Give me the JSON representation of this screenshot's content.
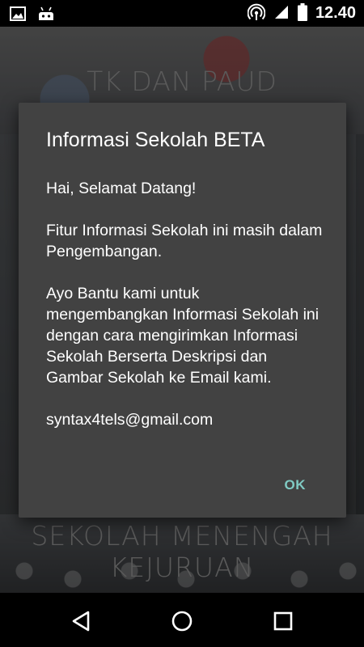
{
  "status_bar": {
    "time": "12.40",
    "icons": [
      "image-icon",
      "android-icon",
      "hotspot-icon",
      "signal-icon",
      "battery-icon"
    ]
  },
  "app": {
    "banner_top_title": "TK DAN PAUD",
    "banner_bottom_title": "SEKOLAH MENENGAH KEJURUAN"
  },
  "dialog": {
    "title": "Informasi Sekolah BETA",
    "paragraphs": [
      "Hai, Selamat Datang!",
      "Fitur Informasi Sekolah ini masih dalam Pengembangan.",
      "Ayo Bantu kami untuk mengembangkan Informasi Sekolah ini dengan cara mengirimkan Informasi Sekolah Berserta Deskripsi dan Gambar Sekolah ke Email kami.",
      "syntax4tels@gmail.com"
    ],
    "ok_label": "OK",
    "accent_color": "#80cbc4"
  },
  "nav_bar": {
    "icons": [
      "back-icon",
      "home-icon",
      "recents-icon"
    ]
  }
}
